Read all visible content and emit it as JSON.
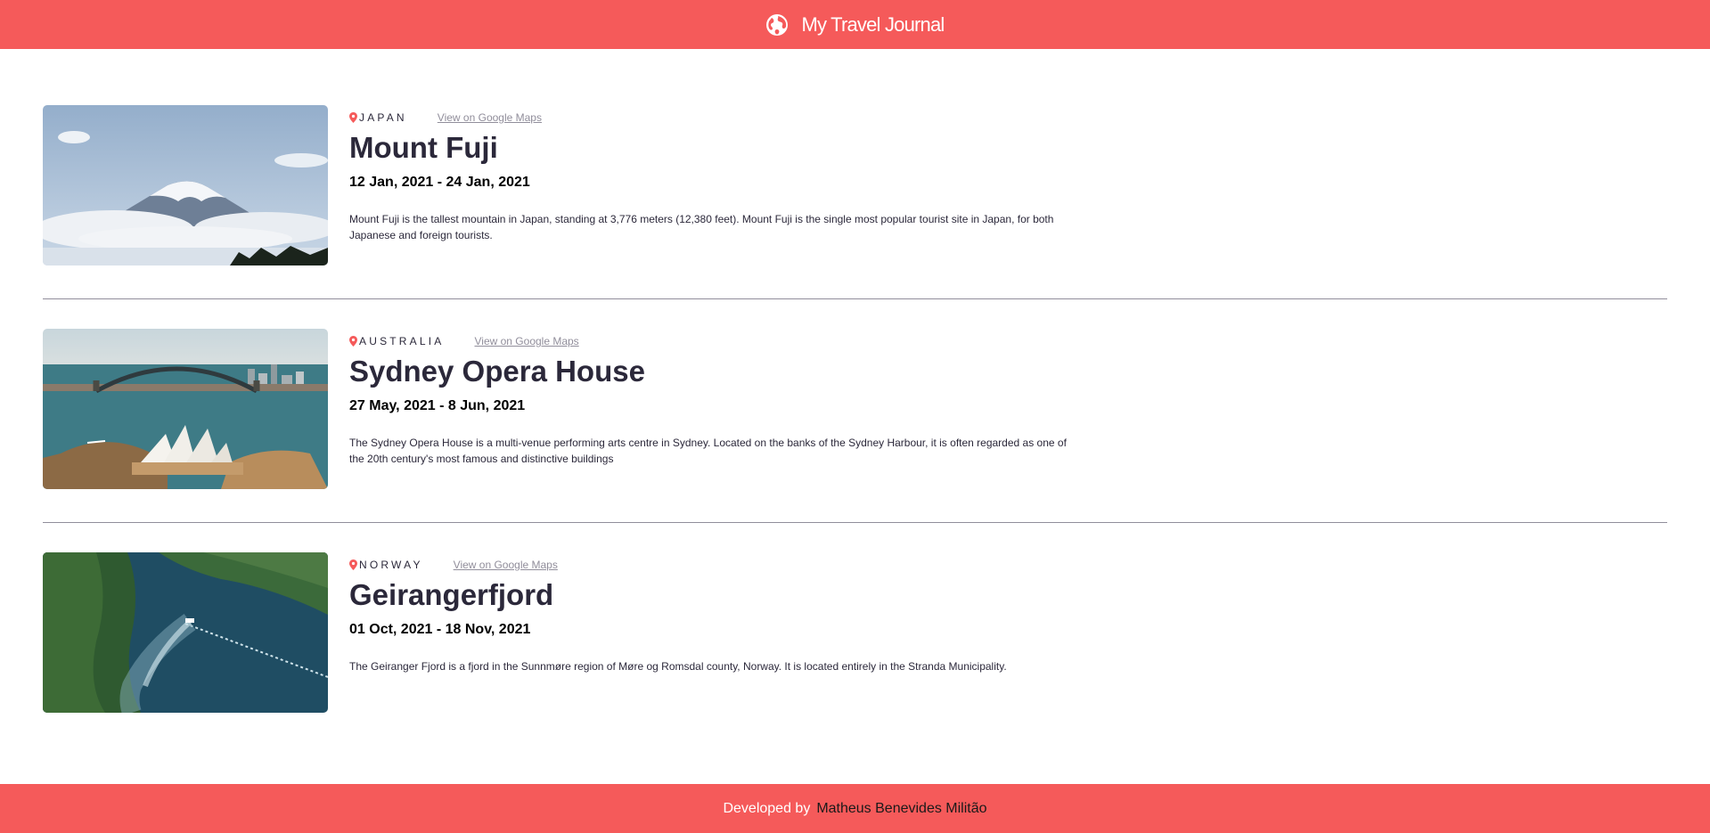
{
  "header": {
    "title": "My Travel Journal",
    "icon": "globe-icon"
  },
  "entries": [
    {
      "location": "JAPAN",
      "maps_link": "View on Google Maps",
      "title": "Mount Fuji",
      "dates": "12 Jan, 2021 - 24 Jan, 2021",
      "description": "Mount Fuji is the tallest mountain in Japan, standing at 3,776 meters (12,380 feet). Mount Fuji is the single most popular tourist site in Japan, for both Japanese and foreign tourists."
    },
    {
      "location": "AUSTRALIA",
      "maps_link": "View on Google Maps",
      "title": "Sydney Opera House",
      "dates": "27 May, 2021 - 8 Jun, 2021",
      "description": "The Sydney Opera House is a multi-venue performing arts centre in Sydney. Located on the banks of the Sydney Harbour, it is often regarded as one of the 20th century's most famous and distinctive buildings"
    },
    {
      "location": "NORWAY",
      "maps_link": "View on Google Maps",
      "title": "Geirangerfjord",
      "dates": "01 Oct, 2021 - 18 Nov, 2021",
      "description": "The Geiranger Fjord is a fjord in the Sunnmøre region of Møre og Romsdal county, Norway. It is located entirely in the Stranda Municipality."
    }
  ],
  "footer": {
    "prefix": "Developed by",
    "author": "Matheus Benevides Militão"
  },
  "colors": {
    "accent": "#f55a5a",
    "text": "#2b283a",
    "muted": "#918e9b"
  }
}
